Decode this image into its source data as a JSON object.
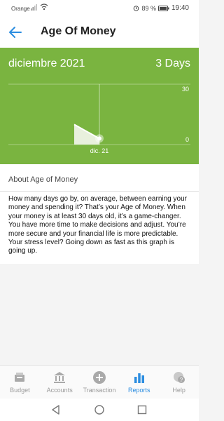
{
  "status": {
    "carrier": "Orange",
    "battery": "89 %",
    "time": "19:40"
  },
  "header": {
    "title": "Age Of Money",
    "back_icon": "arrow-left-icon"
  },
  "chart": {
    "month": "diciembre 2021",
    "value": "3 Days",
    "bg": "#7ab440",
    "accent": "#2b8de0"
  },
  "chart_data": {
    "type": "line",
    "y_ticks": [
      "30",
      "0"
    ],
    "x_tick": "dic. 21",
    "ylim": [
      0,
      30
    ],
    "series": [
      {
        "values": [
          10,
          3
        ]
      }
    ]
  },
  "about": {
    "title": "About Age of Money",
    "description": "How many days go by, on average, between earning your money and spending it? That’s your Age of Money. When your money is at least 30 days old, it’s a game-changer. You have more time to make decisions and adjust. You’re more secure and your financial life is more predictable. Your stress level? Going down as fast as this graph is going up."
  },
  "nav": {
    "items": [
      {
        "label": "Budget",
        "icon": "budget-icon"
      },
      {
        "label": "Accounts",
        "icon": "bank-icon"
      },
      {
        "label": "Transaction",
        "icon": "plus-circle-icon"
      },
      {
        "label": "Reports",
        "icon": "bar-chart-icon"
      },
      {
        "label": "Help",
        "icon": "help-icon"
      }
    ],
    "active": "Reports"
  }
}
